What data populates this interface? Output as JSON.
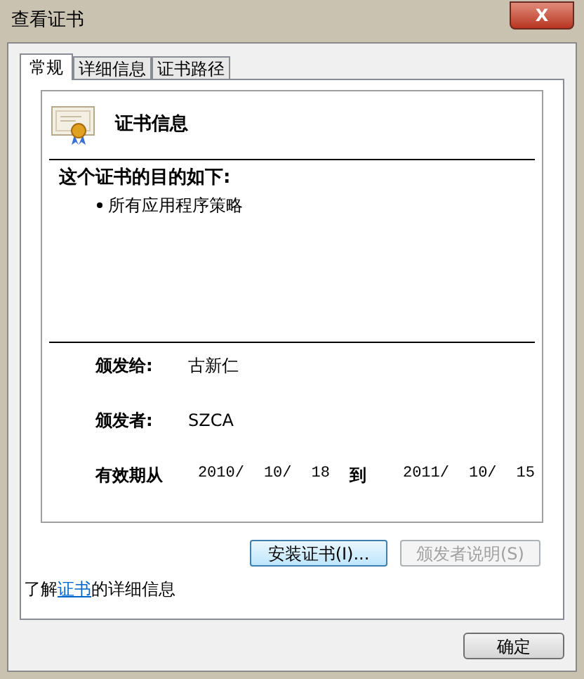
{
  "window": {
    "title": "查看证书",
    "close_label": "X"
  },
  "tabs": [
    {
      "label": "常规",
      "selected": true
    },
    {
      "label": "详细信息",
      "selected": false
    },
    {
      "label": "证书路径",
      "selected": false
    }
  ],
  "certificate": {
    "heading": "证书信息",
    "purpose_title": "这个证书的目的如下:",
    "purposes": [
      "所有应用程序策略"
    ],
    "fields": [
      {
        "label": "颁发给:",
        "value": "古新仁"
      },
      {
        "label": "颁发者:",
        "value": "SZCA"
      }
    ],
    "validity": {
      "label": "有效期从",
      "from": [
        "2010/",
        "10/",
        "18"
      ],
      "to_label": "到",
      "to": [
        "2011/",
        "10/",
        "15"
      ]
    }
  },
  "buttons": [
    {
      "label": "安装证书(I)...",
      "disabled": false
    },
    {
      "label": "颁发者说明(S)",
      "disabled": true
    }
  ],
  "info_line": {
    "before": "了解",
    "link": "证书",
    "after": "的详细信息"
  },
  "ok_button": "确定"
}
